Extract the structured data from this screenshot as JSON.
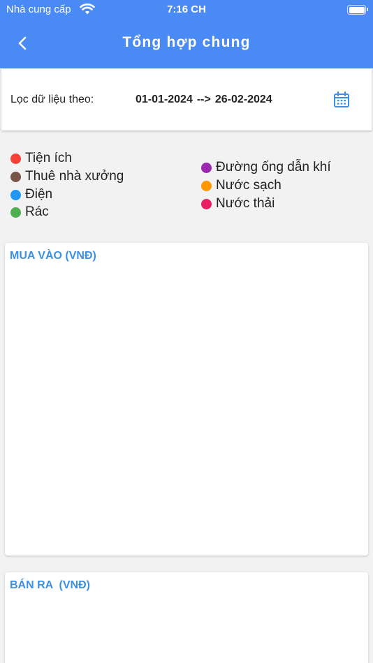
{
  "status_bar": {
    "carrier": "Nhà cung cấp",
    "time": "7:16 CH",
    "wifi_icon": "wifi-icon",
    "battery_icon": "battery-icon"
  },
  "header": {
    "title": "Tổng hợp chung",
    "back_icon": "chevron-left-icon",
    "background": "#4a8af4"
  },
  "filter": {
    "label": "Lọc dữ liệu theo:",
    "start_date": "01-01-2024",
    "separator": "-->",
    "end_date": "26-02-2024",
    "calendar_icon": "calendar-icon",
    "accent": "#3d8fe0"
  },
  "legend": [
    {
      "label": "Tiện ích",
      "color": "#f44336"
    },
    {
      "label": "Thuê nhà xưởng",
      "color": "#795548"
    },
    {
      "label": "Điện",
      "color": "#2196f3"
    },
    {
      "label": "Rác",
      "color": "#4caf50"
    },
    {
      "label": "Đường ống dẫn khí",
      "color": "#9c27b0"
    },
    {
      "label": "Nước sạch",
      "color": "#ff9800"
    },
    {
      "label": "Nước thải",
      "color": "#e91e63"
    }
  ],
  "cards": {
    "purchase_title": "MUA VÀO (VNĐ)",
    "sales_title": "BÁN RA  (VNĐ)"
  }
}
